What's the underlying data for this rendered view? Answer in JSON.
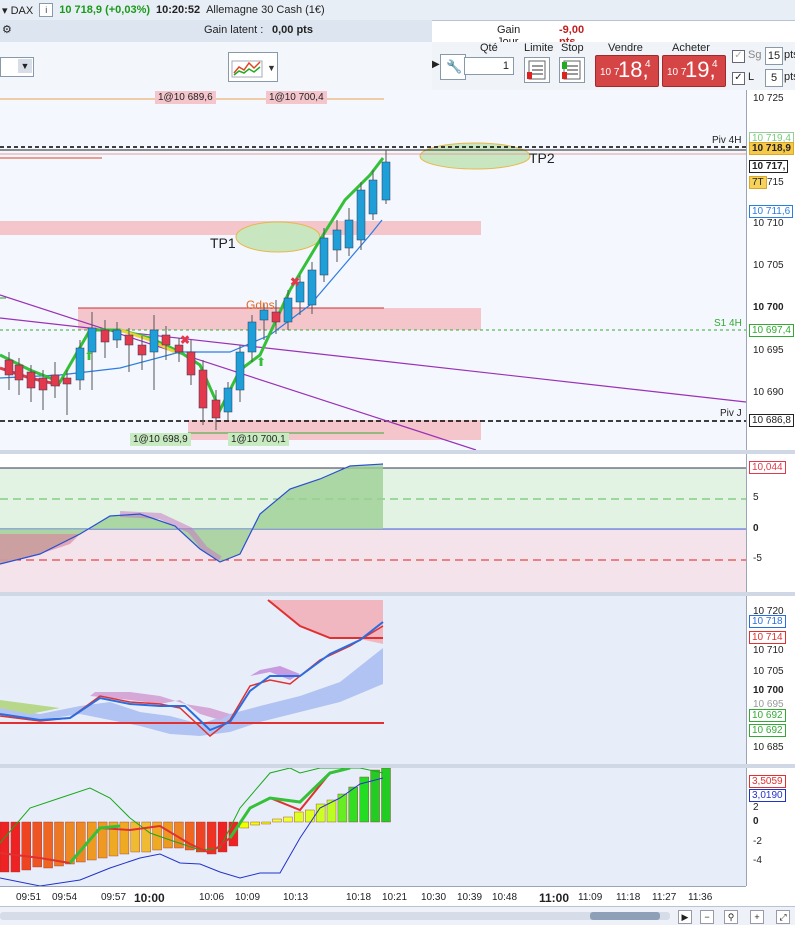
{
  "top": {
    "instrument": "DAX",
    "info_icon": "i",
    "last_price": "10 718,9 (+0,03%)",
    "time": "10:20:52",
    "title": "Allemagne 30 Cash (1€)"
  },
  "gains": {
    "latent_label": "Gain latent :",
    "latent_value": "0,00 pts",
    "jour_label": "Gain Jour :",
    "jour_value": "-9,00 pts"
  },
  "order": {
    "qty_label": "Qté",
    "qty_value": "1",
    "limit_label": "Limite",
    "stop_label": "Stop",
    "sell_label": "Vendre",
    "buy_label": "Acheter",
    "sell_small": "10 7",
    "sell_big": "18,",
    "sell_sup": "4",
    "buy_small": "10 7",
    "buy_big": "19,",
    "buy_sup": "4",
    "sg_label": "Sg",
    "sg_pts": "15",
    "l_label": "L",
    "l_pts": "5",
    "pts": "pts"
  },
  "price_axis": {
    "ticks": [
      "10 725",
      "10 710",
      "10 705",
      "10 700",
      "10 695",
      "10 690"
    ],
    "tags": {
      "cur": "10 718,9",
      "tag2": "10 717,",
      "tag3": "10 719,4",
      "tag4": "10 711,6",
      "tag5": "10 697,4",
      "tag6": "10 686,8",
      "tag7": "715",
      "tt": "7T"
    }
  },
  "annotations": {
    "tp1": "TP1",
    "tp2": "TP2",
    "piv4h": "Piv 4H",
    "s14h": "S1 4H",
    "pivj": "Piv J",
    "ord1": "1@10 689,6",
    "ord2": "1@10 700,4",
    "ord3": "1@10 698,9",
    "ord4": "1@10 700,1",
    "gdns": "Gdns"
  },
  "osc1": {
    "ticks": [
      "5",
      "0",
      "-5"
    ],
    "tag": "10,044"
  },
  "ichi": {
    "ticks": [
      "10 720",
      "10 710",
      "10 705",
      "10 700",
      "10 695",
      "10 685"
    ],
    "tags": {
      "a": "10 718",
      "b": "10 714",
      "c": "10 692",
      "d": "10 692"
    }
  },
  "hist": {
    "ticks": [
      "2",
      "0",
      "-2",
      "-4"
    ],
    "tags": {
      "a": "3,5059",
      "b": "3,0190"
    }
  },
  "time_axis": [
    "09:51",
    "09:54",
    "09:57",
    "10:00",
    "10:06",
    "10:09",
    "10:13",
    "10:18",
    "10:21",
    "10:30",
    "10:39",
    "10:48",
    "11:00",
    "11:09",
    "11:18",
    "11:27",
    "11:36"
  ],
  "colors": {
    "bull": "#1e9fd8",
    "bear": "#e23a4c",
    "green_band": "#b9e2b9",
    "pink_band": "#f2c0c6",
    "sell_btn": "#d64545"
  }
}
